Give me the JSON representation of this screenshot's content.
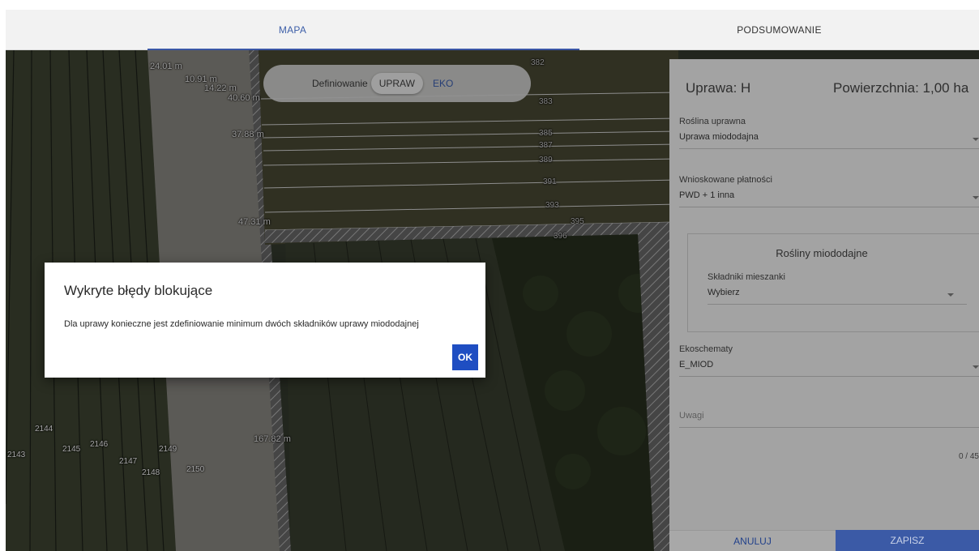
{
  "tabs": {
    "map": "MAPA",
    "summary": "PODSUMOWANIE"
  },
  "mode_toggle": {
    "label": "Definiowanie",
    "option_active": "UPRAW",
    "option_other": "EKO"
  },
  "map": {
    "parcel_numbers": [
      "382",
      "383",
      "385",
      "387",
      "389",
      "391",
      "393",
      "395",
      "396",
      "2143",
      "2144",
      "2145",
      "2146",
      "2147",
      "2148",
      "2149",
      "2150"
    ],
    "measurements": [
      "24.01 m",
      "10.91 m",
      "14.22 m",
      "40.60 m",
      "37.88 m",
      "47.31 m",
      "167.82 m"
    ]
  },
  "panel": {
    "title": "Uprawa: H",
    "area": "Powierzchnia: 1,00 ha",
    "crop": {
      "label": "Roślina uprawna",
      "value": "Uprawa miododajna"
    },
    "payments": {
      "label": "Wnioskowane płatności",
      "value": "PWD + 1 inna"
    },
    "melliferous": {
      "title": "Rośliny miododajne",
      "mix": {
        "label": "Składniki mieszanki",
        "value": "Wybierz"
      }
    },
    "ecoschemes": {
      "label": "Ekoschematy",
      "value": "E_MIOD"
    },
    "notes": {
      "placeholder": "Uwagi",
      "counter": "0 / 45"
    },
    "cancel_label": "ANULUJ",
    "save_label": "ZAPISZ"
  },
  "dialog": {
    "title": "Wykryte błędy blokujące",
    "message": "Dla uprawy konieczne jest zdefiniowanie minimum dwóch składników uprawy miododajnej",
    "ok_label": "OK"
  }
}
